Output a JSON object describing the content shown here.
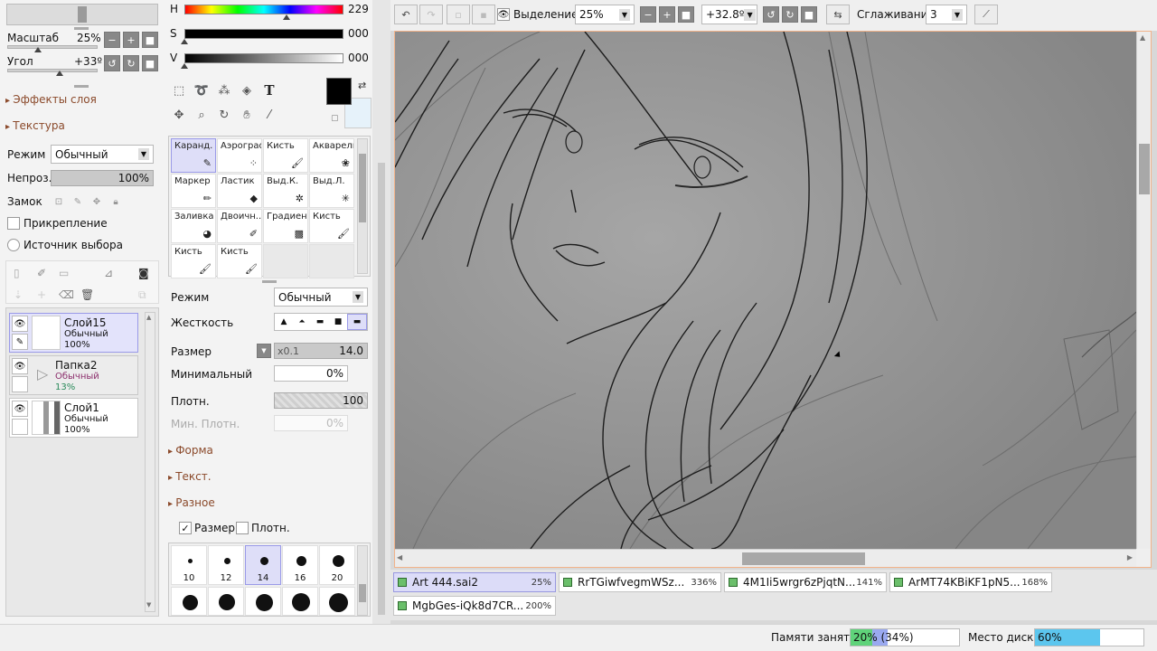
{
  "left_panel": {
    "scale_label": "Масштаб",
    "scale_value": "25%",
    "angle_label": "Угол",
    "angle_value": "+33º",
    "layer_effects": "Эффекты слоя",
    "texture": "Текстура",
    "mode_label": "Режим",
    "mode_value": "Обычный",
    "opacity_label": "Непроз.",
    "opacity_value": "100%",
    "lock_label": "Замок",
    "clipping_label": "Прикрепление",
    "selection_source_label": "Источник выбора"
  },
  "layers": [
    {
      "name": "Слой15",
      "mode": "Обычный",
      "opacity": "100%",
      "selected": true
    },
    {
      "name": "Папка2",
      "mode": "Обычный",
      "opacity": "13%",
      "folder": true
    },
    {
      "name": "Слой1",
      "mode": "Обычный",
      "opacity": "100%"
    }
  ],
  "color": {
    "h_label": "H",
    "h_value": "229",
    "h_level": 0.64,
    "s_label": "S",
    "s_value": "000",
    "s_level": 0.0,
    "v_label": "V",
    "v_value": "000",
    "v_level": 0.0,
    "primary": "#000000",
    "secondary": "#e6f2fa"
  },
  "tool_icons": [
    "marquee-icon",
    "lasso-icon",
    "magic-wand-icon",
    "fill-select-icon",
    "text-icon",
    "move-icon",
    "zoom-icon",
    "rotate-icon",
    "hand-icon",
    "eyedropper-icon"
  ],
  "text_tool_glyph": "T",
  "brushes": [
    {
      "name": "Каранд.",
      "icon": "pencil-icon",
      "selected": true
    },
    {
      "name": "Аэрограф",
      "icon": "airbrush-icon"
    },
    {
      "name": "Кисть",
      "icon": "brush-icon"
    },
    {
      "name": "Акварель",
      "icon": "watercolor-icon"
    },
    {
      "name": "Маркер",
      "icon": "marker-icon"
    },
    {
      "name": "Ластик",
      "icon": "eraser-icon"
    },
    {
      "name": "Выд.К.",
      "icon": "select-pen-icon"
    },
    {
      "name": "Выд.Л.",
      "icon": "select-eraser-icon"
    },
    {
      "name": "Заливка",
      "icon": "bucket-icon"
    },
    {
      "name": "Двоичн...",
      "icon": "binary-pen-icon"
    },
    {
      "name": "Градиент",
      "icon": "gradient-icon"
    },
    {
      "name": "Кисть",
      "icon": "brush-icon"
    },
    {
      "name": "Кисть",
      "icon": "brush-icon"
    },
    {
      "name": "Кисть",
      "icon": "brush-icon"
    }
  ],
  "brush_settings": {
    "mode_label": "Режим",
    "mode_value": "Обычный",
    "hardness_label": "Жесткость",
    "size_label": "Размер",
    "size_multiplier": "x0.1",
    "size_value": "14.0",
    "min_label": "Минимальный",
    "min_value": "0%",
    "density_label": "Плотн.",
    "density_value": "100",
    "min_density_label": "Мин. Плотн.",
    "min_density_value": "0%",
    "shape_section": "Форма",
    "texture_section": "Текст.",
    "misc_section": "Разное",
    "size_check_label": "Размер",
    "density_check_label": "Плотн."
  },
  "brush_sizes_top": [
    "10",
    "12",
    "14",
    "16",
    "20"
  ],
  "toolbar": {
    "selection_label": "Выделение",
    "zoom_value": "25%",
    "angle_value": "+32.8º",
    "smoothing_label": "Сглаживание",
    "smoothing_value": "3"
  },
  "documents": [
    {
      "name": "Art 444.sai2",
      "zoom": "25%",
      "active": true
    },
    {
      "name": "RrTGiwfvegmWSz...",
      "zoom": "336%"
    },
    {
      "name": "4M1Ii5wrgr6zPjqtN...",
      "zoom": "141%"
    },
    {
      "name": "ArMT74KBiKF1pN5...",
      "zoom": "168%"
    },
    {
      "name": "MgbGes-iQk8d7CR...",
      "zoom": "200%"
    }
  ],
  "status": {
    "memory_label": "Памяти занято",
    "memory_value": "20% (34%)",
    "memory_level": 0.2,
    "memory_level_total": 0.34,
    "disk_label": "Место диска",
    "disk_value": "60%",
    "disk_level": 0.6
  }
}
